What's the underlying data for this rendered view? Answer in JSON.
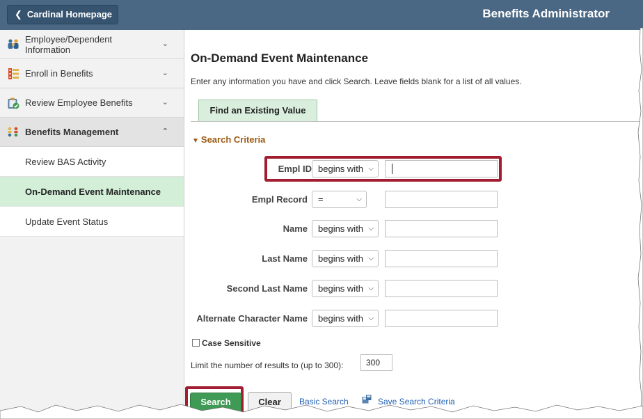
{
  "header": {
    "home_button": "Cardinal Homepage",
    "title": "Benefits Administrator"
  },
  "sidebar": {
    "items": [
      {
        "label_line1": "Employee/Dependent",
        "label_line2": "Information",
        "icon": "people-icon"
      },
      {
        "label": "Enroll in Benefits",
        "icon": "enroll-list-icon"
      },
      {
        "label": "Review Employee Benefits",
        "icon": "clipboard-check-icon"
      },
      {
        "label": "Benefits Management",
        "icon": "management-icon",
        "expanded": true
      }
    ],
    "subitems": [
      {
        "label": "Review BAS Activity"
      },
      {
        "label": "On-Demand Event Maintenance",
        "selected": true
      },
      {
        "label": "Update Event Status"
      }
    ]
  },
  "main": {
    "title": "On-Demand Event Maintenance",
    "instructions": "Enter any information you have and click Search. Leave fields blank for a list of all values.",
    "tab": "Find an Existing Value",
    "section_title": "Search Criteria",
    "fields": [
      {
        "label": "Empl ID",
        "operator": "begins with",
        "value": ""
      },
      {
        "label": "Empl Record",
        "operator": "=",
        "value": ""
      },
      {
        "label": "Name",
        "operator": "begins with",
        "value": ""
      },
      {
        "label": "Last Name",
        "operator": "begins with",
        "value": ""
      },
      {
        "label": "Second Last Name",
        "operator": "begins with",
        "value": ""
      },
      {
        "label": "Alternate Character Name",
        "operator": "begins with",
        "value": ""
      }
    ],
    "case_sensitive_label": "Case Sensitive",
    "limit_label": "Limit the number of results to (up to 300):",
    "limit_value": "300",
    "search_button": "Search",
    "clear_button": "Clear",
    "basic_search_link": "Basic Search",
    "save_search_link": "Save Search Criteria"
  },
  "colors": {
    "header_bg": "#4a6884",
    "selected_item_bg": "#d3efd8",
    "search_button": "#3f9a55",
    "highlight_box": "#a11d2f",
    "section_title": "#9c5a14",
    "link": "#1f5fb4"
  }
}
